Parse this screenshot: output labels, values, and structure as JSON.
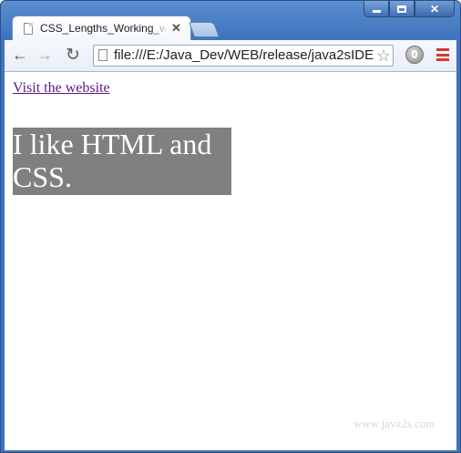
{
  "browser": {
    "tab_title": "CSS_Lengths_Working_wit",
    "tab_close": "✕",
    "url": "file:///E:/Java_Dev/WEB/release/java2sIDE",
    "window_controls": {
      "minimize": "minimize",
      "maximize": "maximize",
      "close": "✕"
    },
    "toolbar": {
      "back": "←",
      "forward": "→",
      "reload": "↻",
      "star": "☆"
    }
  },
  "page": {
    "link_text": "Visit the website",
    "box_text": "I like HTML and CSS.",
    "watermark": "www.java2s.com"
  },
  "colors": {
    "box_background": "#808080",
    "box_text": "#ffffff",
    "link": "#551a8b"
  }
}
